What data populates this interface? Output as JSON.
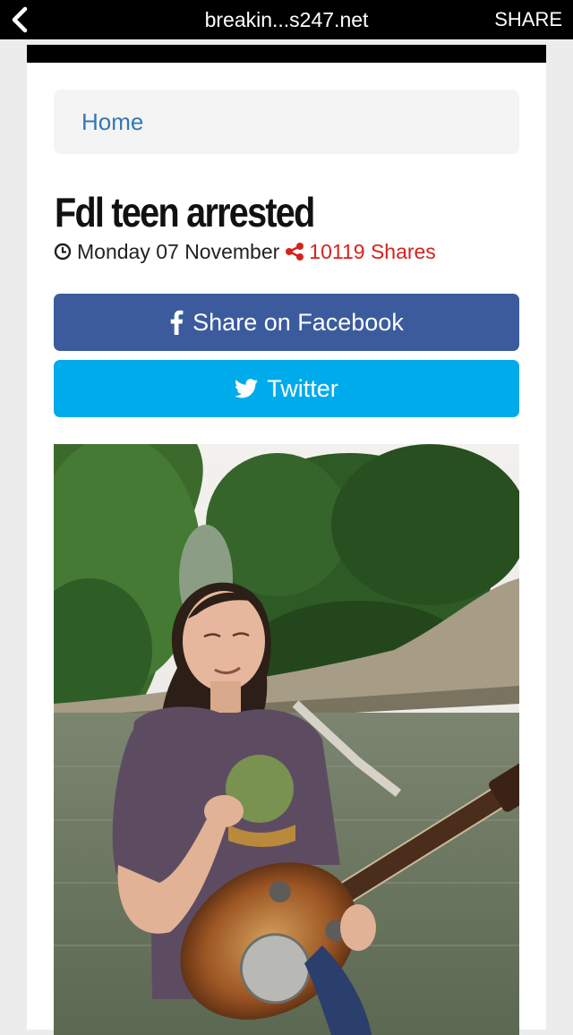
{
  "browser": {
    "url": "breakin...s247.net",
    "share_label": "SHARE",
    "back_icon": "chevron-left-icon"
  },
  "breadcrumb": {
    "home_label": "Home"
  },
  "article": {
    "title": "Fdl teen arrested",
    "date": "Monday 07 November",
    "shares": "10119 Shares"
  },
  "buttons": {
    "facebook_label": "Share on Facebook",
    "twitter_label": "Twitter"
  },
  "colors": {
    "facebook": "#3b5b9d",
    "twitter": "#00abeb",
    "link": "#3478b4",
    "shares": "#d6221c"
  }
}
